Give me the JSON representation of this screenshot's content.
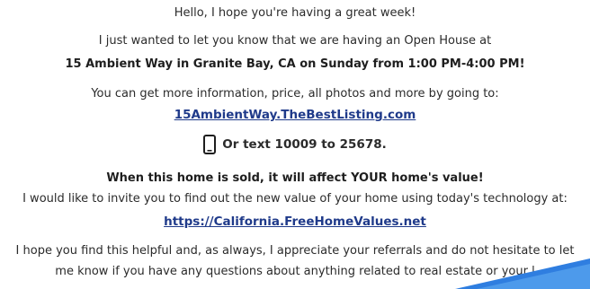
{
  "email": {
    "greeting": "Hello, I hope you're having a great week!",
    "intro": "I just wanted to let you know that we are having an Open House at",
    "open_house_details": "15 Ambient Way in Granite Bay, CA on Sunday from 1:00 PM-4:00 PM!",
    "more_info": "You can get more information, price, all photos and more by going to:",
    "listing_link": "15AmbientWay.TheBestListing.com",
    "text_cta": "Or text 10009 to 25678.",
    "home_value_headline": "When this home is sold, it will affect YOUR home's value!",
    "invite": "I would like to invite you to find out the new value of your home using today's technology at:",
    "home_values_link": "https://California.FreeHomeValues.net",
    "closing_line1": "I hope you find this helpful and, as always, I appreciate your referrals and do not hesitate to let",
    "closing_line2": "me know if you have any questions about anything related to real estate or your l"
  },
  "icons": {
    "phone": "smartphone-icon"
  },
  "colors": {
    "link": "#1f3a8a",
    "text": "#2b2b2b",
    "corner_accent": "#2f7ee0"
  }
}
